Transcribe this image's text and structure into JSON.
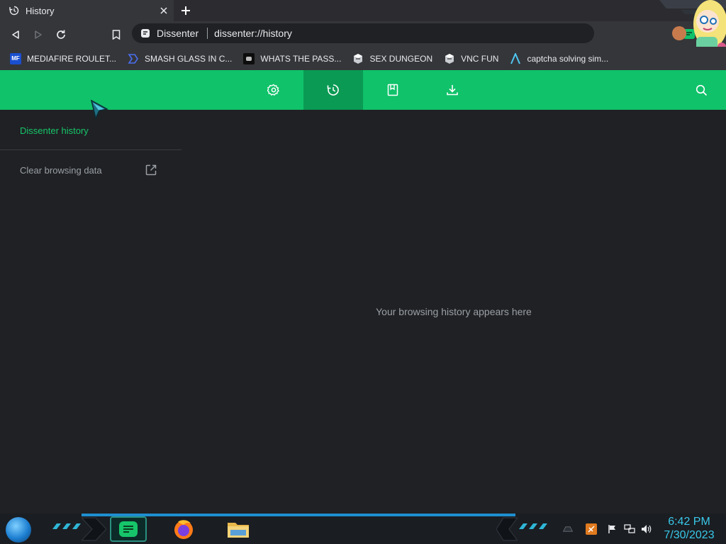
{
  "tab": {
    "title": "History"
  },
  "toolbar": {
    "site_label": "Dissenter",
    "url": "dissenter://history"
  },
  "bookmarks": [
    {
      "label": "MEDIAFIRE ROULET...",
      "icon": "mediafire-icon"
    },
    {
      "label": "SMASH GLASS IN C...",
      "icon": "chevron-icon"
    },
    {
      "label": "WHATS THE PASS...",
      "icon": "discord-icon"
    },
    {
      "label": "SEX DUNGEON",
      "icon": "game-icon"
    },
    {
      "label": "VNC FUN",
      "icon": "game-icon"
    },
    {
      "label": "captcha solving sim...",
      "icon": "a-icon"
    }
  ],
  "sidebar": {
    "title": "Dissenter history",
    "clear_label": "Clear browsing data"
  },
  "main": {
    "empty_message": "Your browsing history appears here"
  },
  "taskbar": {
    "time": "6:42 PM",
    "date": "7/30/2023"
  },
  "colors": {
    "accent": "#10c26a",
    "accent_active": "#0a9a54",
    "page_bg": "#202124",
    "clock": "#39c8e8"
  }
}
